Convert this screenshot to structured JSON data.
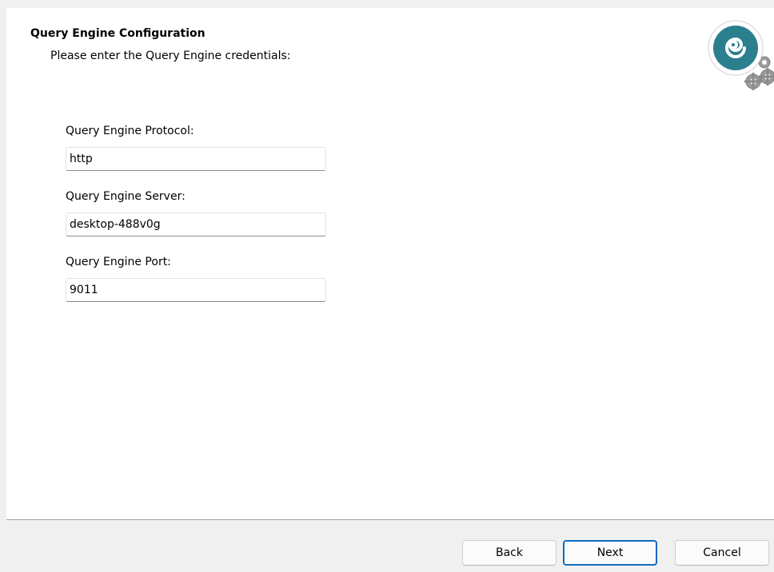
{
  "header": {
    "title": "Query Engine Configuration",
    "subtitle": "Please enter the Query Engine credentials:",
    "logo_icon": "swirl-gears-logo-icon"
  },
  "form": {
    "protocol_label": "Query Engine Protocol:",
    "protocol_value": "http",
    "server_label": "Query Engine Server:",
    "server_value": "desktop-488v0g",
    "port_label": "Query Engine Port:",
    "port_value": "9011"
  },
  "footer": {
    "back_label": "Back",
    "next_label": "Next",
    "cancel_label": "Cancel"
  },
  "colors": {
    "logo_teal": "#2b7f8f",
    "default_button_border": "#0f6cbd",
    "content_background": "#ffffff",
    "footer_background": "#f0f0f0"
  }
}
